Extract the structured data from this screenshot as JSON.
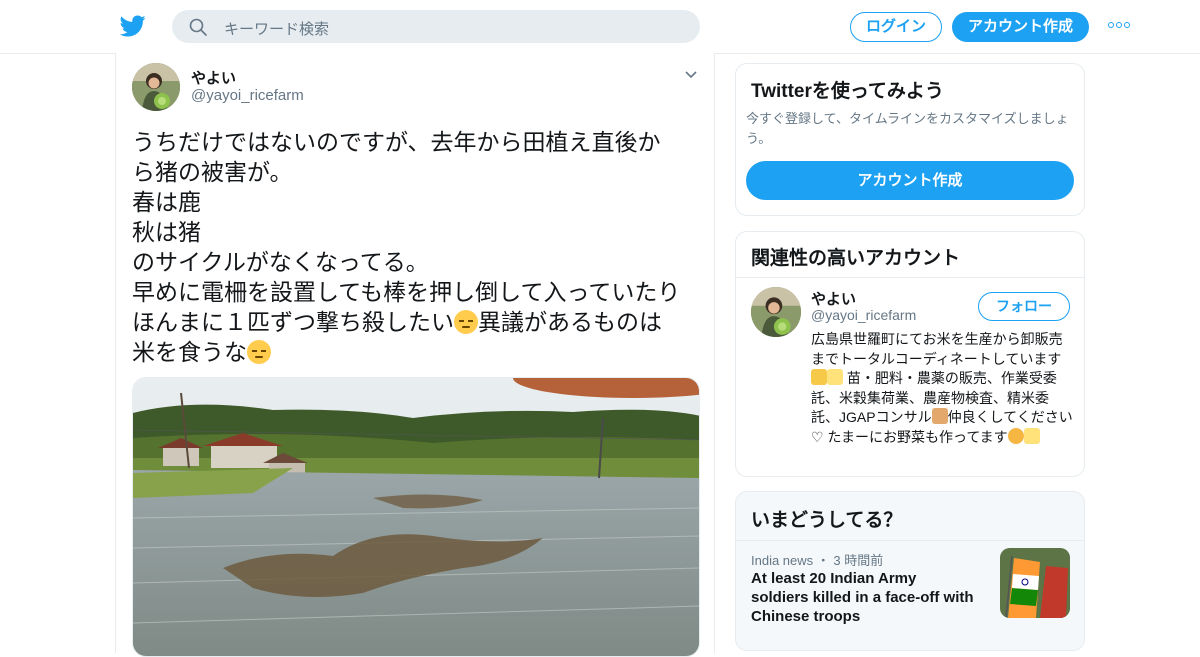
{
  "header": {
    "search_placeholder": "キーワード検索",
    "login_label": "ログイン",
    "signup_label": "アカウント作成",
    "brand_color": "#1da1f2"
  },
  "tweet": {
    "author_name": "やよい",
    "author_handle": "@yayoi_ricefarm",
    "lines": [
      "うちだけではないのですが、去年から田植え直後か",
      "ら猪の被害が。",
      "春は鹿",
      "秋は猪",
      "のサイクルがなくなってる。",
      "早めに電柵を設置しても棒を押し倒して入っていたり"
    ],
    "line7_a": "ほんまに１匹ずつ撃ち殺したい",
    "line7_b": "異議があるものは",
    "line8": "米を食うな",
    "emoji": "pensive-face"
  },
  "sidebar": {
    "signup_card": {
      "title": "Twitterを使ってみよう",
      "subtitle": "今すぐ登録して、タイムラインをカスタマイズしましょう。",
      "button_label": "アカウント作成"
    },
    "related_card": {
      "title": "関連性の高いアカウント",
      "name": "やよい",
      "handle": "@yayoi_ricefarm",
      "follow_label": "フォロー",
      "bio_1": "広島県世羅町にてお米を生産から卸販売までトータルコーディネートしています",
      "bio_2": " 苗・肥料・農薬の販売、作業受委託、米穀集荷業、農産物検査、精米委託、JGAPコンサル",
      "bio_3": "仲良くしてください♡ たまーにお野菜も作ってます"
    },
    "trends_card": {
      "title": "いまどうしてる？",
      "source": "India news",
      "dot": "・",
      "time": "3 時間前",
      "headline": "At least 20 Indian Army soldiers killed in a face-off with Chinese troops"
    }
  }
}
